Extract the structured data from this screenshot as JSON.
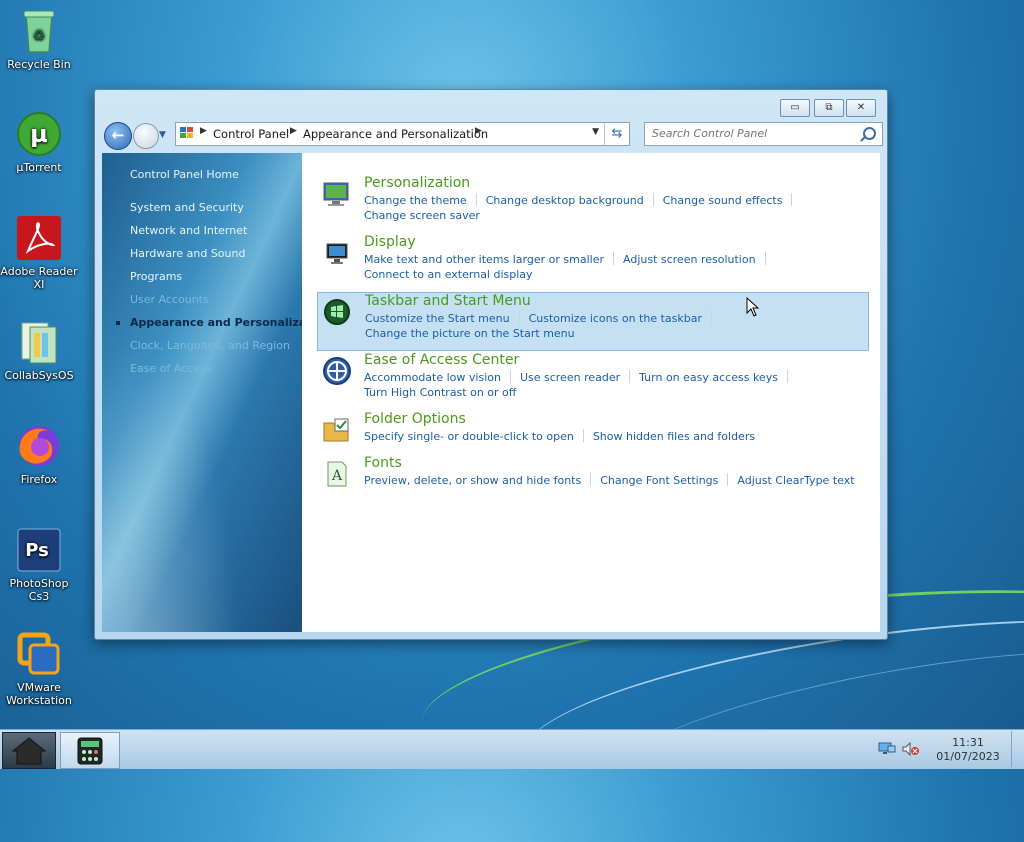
{
  "desktop": {
    "icons": [
      {
        "label": "Recycle Bin"
      },
      {
        "label": "µTorrent"
      },
      {
        "label": "Adobe Reader XI"
      },
      {
        "label": "CollabSysOS"
      },
      {
        "label": "Firefox"
      },
      {
        "label": "PhotoShop Cs3"
      },
      {
        "label": "VMware Workstation"
      }
    ]
  },
  "window": {
    "controls": {
      "minimize": "▭",
      "maximize": "⧉",
      "close": "✕"
    },
    "address": {
      "crumbs": [
        "Control Panel",
        "Appearance and Personalization"
      ]
    },
    "search": {
      "placeholder": "Search Control Panel"
    },
    "sidebar": {
      "items": [
        "Control Panel Home",
        "System and Security",
        "Network and Internet",
        "Hardware and Sound",
        "Programs",
        "User Accounts",
        "Appearance and Personalization",
        "Clock, Language, and Region",
        "Ease of Access"
      ]
    },
    "categories": [
      {
        "title": "Personalization",
        "links": [
          "Change the theme",
          "Change desktop background",
          "Change sound effects",
          "Change screen saver"
        ]
      },
      {
        "title": "Display",
        "links": [
          "Make text and other items larger or smaller",
          "Adjust screen resolution",
          "Connect to an external display"
        ]
      },
      {
        "title": "Taskbar and Start Menu",
        "links": [
          "Customize the Start menu",
          "Customize icons on the taskbar",
          "Change the picture on the Start menu"
        ]
      },
      {
        "title": "Ease of Access Center",
        "links": [
          "Accommodate low vision",
          "Use screen reader",
          "Turn on easy access keys",
          "Turn High Contrast on or off"
        ]
      },
      {
        "title": "Folder Options",
        "links": [
          "Specify single- or double-click to open",
          "Show hidden files and folders"
        ]
      },
      {
        "title": "Fonts",
        "links": [
          "Preview, delete, or show and hide fonts",
          "Change Font Settings",
          "Adjust ClearType text"
        ]
      }
    ]
  },
  "taskbar": {
    "time": "11:31",
    "date": "01/07/2023"
  }
}
